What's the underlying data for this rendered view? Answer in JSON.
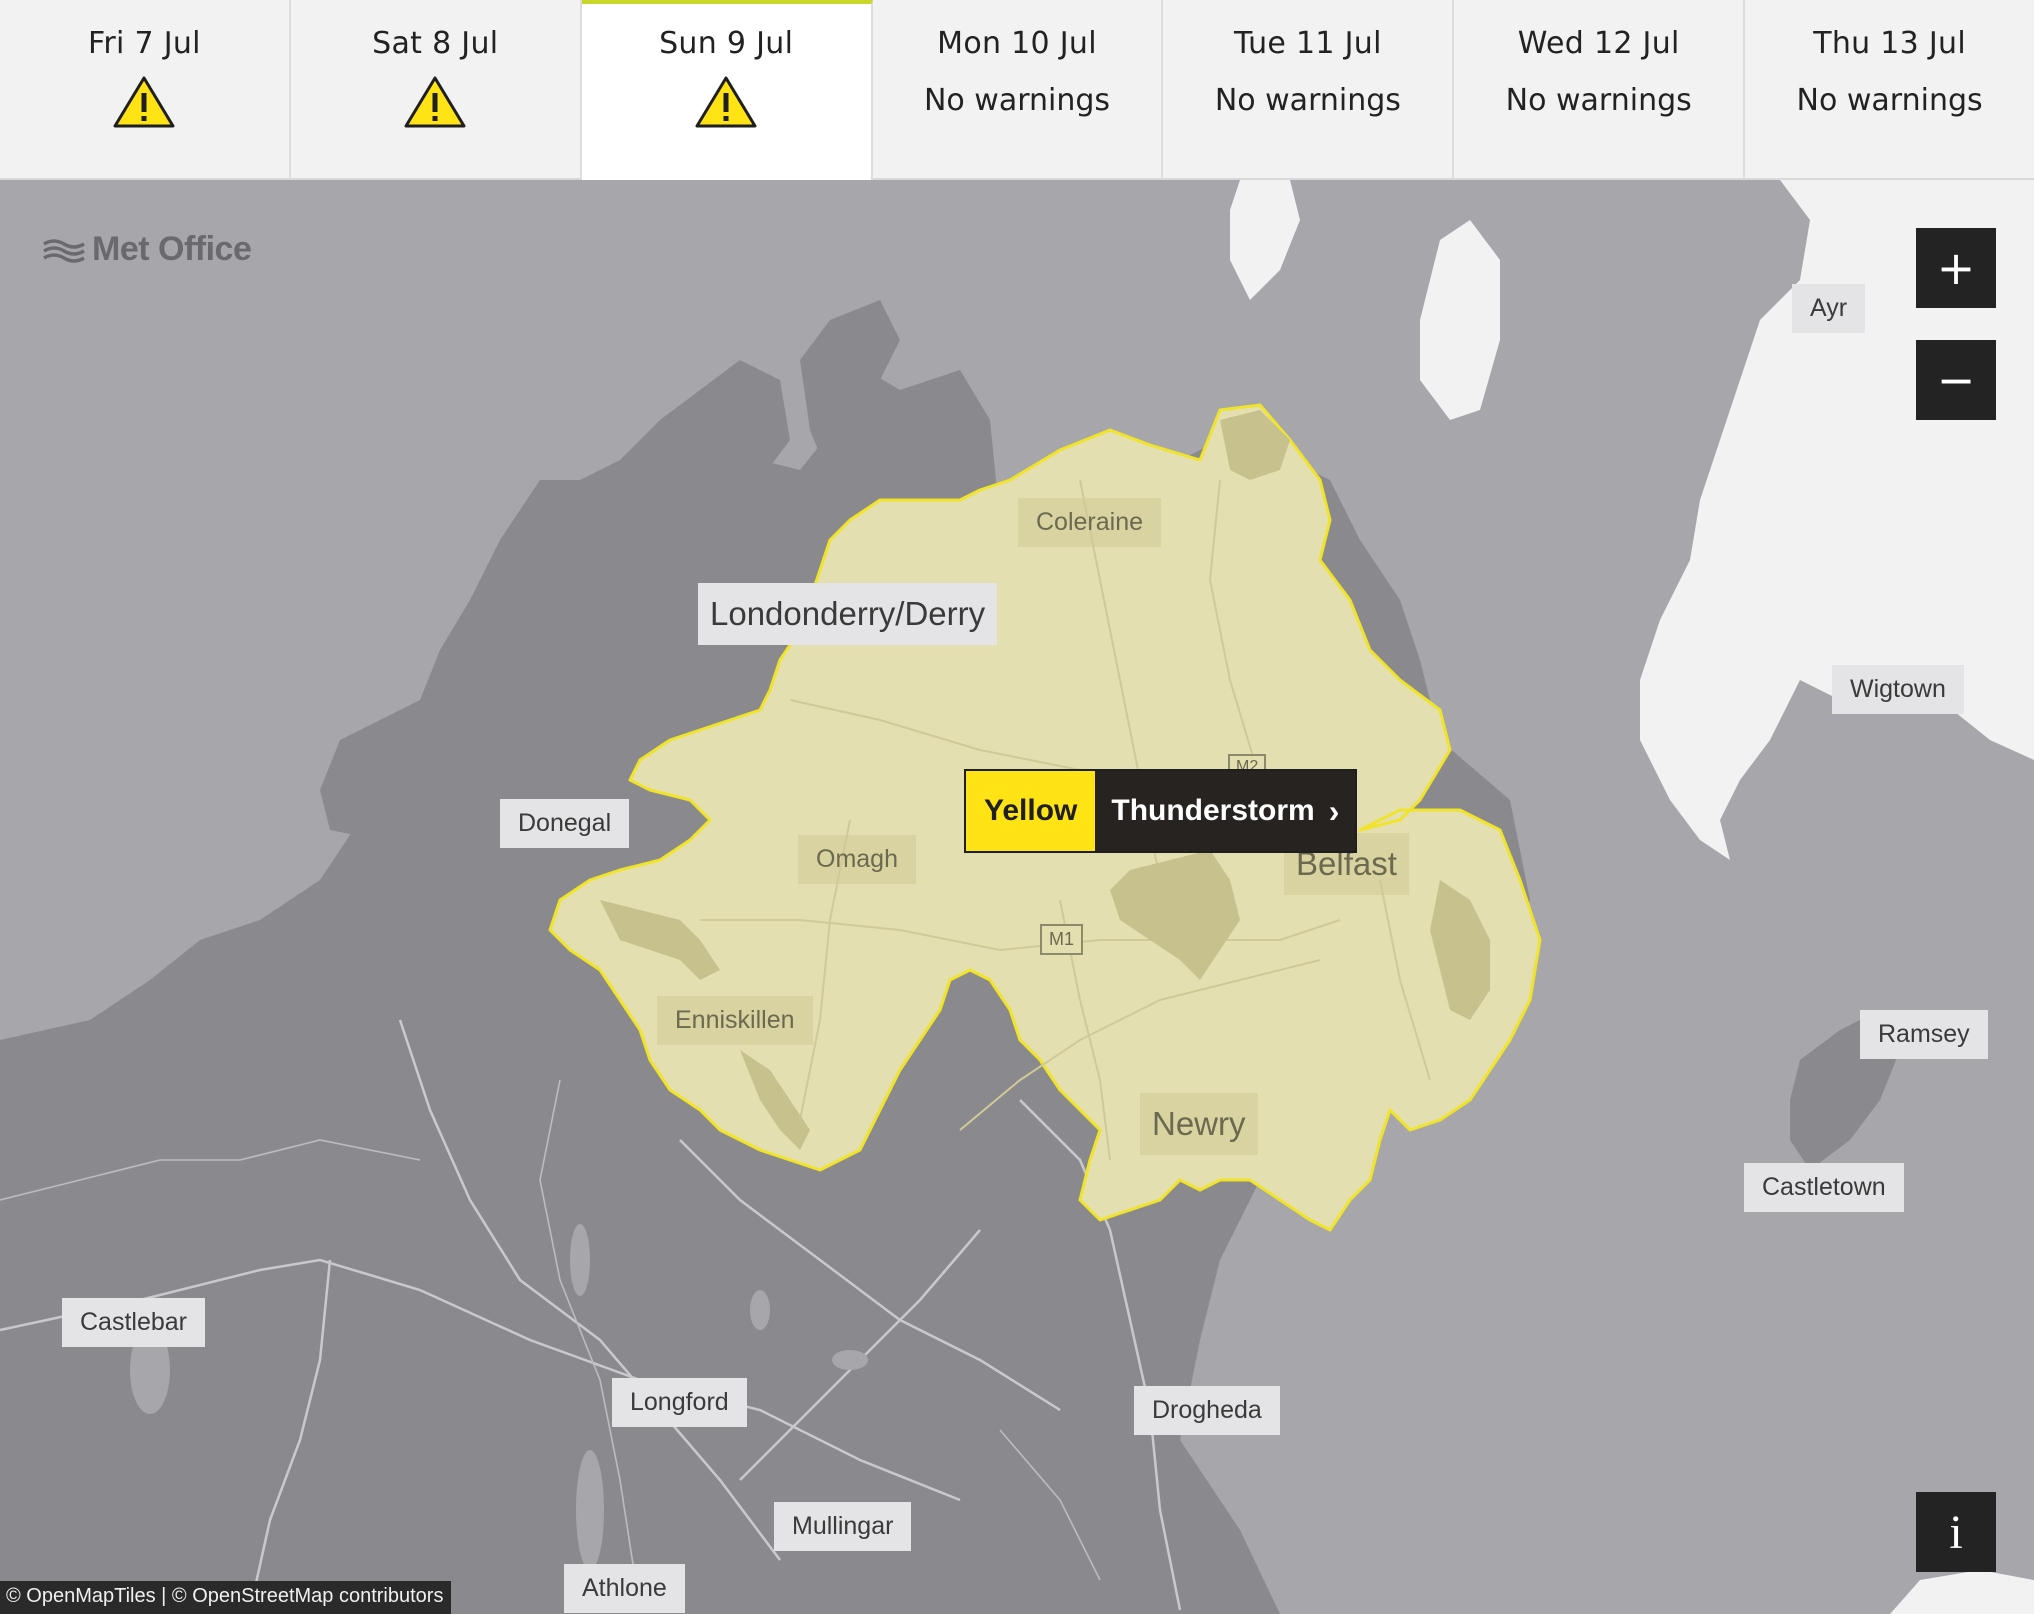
{
  "tabs": [
    {
      "date": "Fri 7 Jul",
      "warning": true,
      "status": ""
    },
    {
      "date": "Sat 8 Jul",
      "warning": true,
      "status": ""
    },
    {
      "date": "Sun 9 Jul",
      "warning": true,
      "status": "",
      "active": true
    },
    {
      "date": "Mon 10 Jul",
      "warning": false,
      "status": "No warnings"
    },
    {
      "date": "Tue 11 Jul",
      "warning": false,
      "status": "No warnings"
    },
    {
      "date": "Wed 12 Jul",
      "warning": false,
      "status": "No warnings"
    },
    {
      "date": "Thu 13 Jul",
      "warning": false,
      "status": "No warnings"
    }
  ],
  "brand": {
    "name": "Met Office"
  },
  "warning": {
    "level": "Yellow",
    "type": "Thunderstorm",
    "chevron": "›",
    "level_color": "#ffe315"
  },
  "places": {
    "londonderry": "Londonderry/Derry",
    "coleraine": "Coleraine",
    "donegal": "Donegal",
    "omagh": "Omagh",
    "enniskillen": "Enniskillen",
    "belfast": "Belfast",
    "newry": "Newry",
    "ayr": "Ayr",
    "wigtown": "Wigtown",
    "ramsey": "Ramsey",
    "castletown": "Castletown",
    "castlebar": "Castlebar",
    "longford": "Longford",
    "drogheda": "Drogheda",
    "mullingar": "Mullingar",
    "athlone": "Athlone"
  },
  "roads": {
    "m1": "M1",
    "m2": "M2"
  },
  "controls": {
    "zoom_in": "+",
    "zoom_out": "−",
    "info": "i"
  },
  "attribution": "© OpenMapTiles | © OpenStreetMap contributors"
}
